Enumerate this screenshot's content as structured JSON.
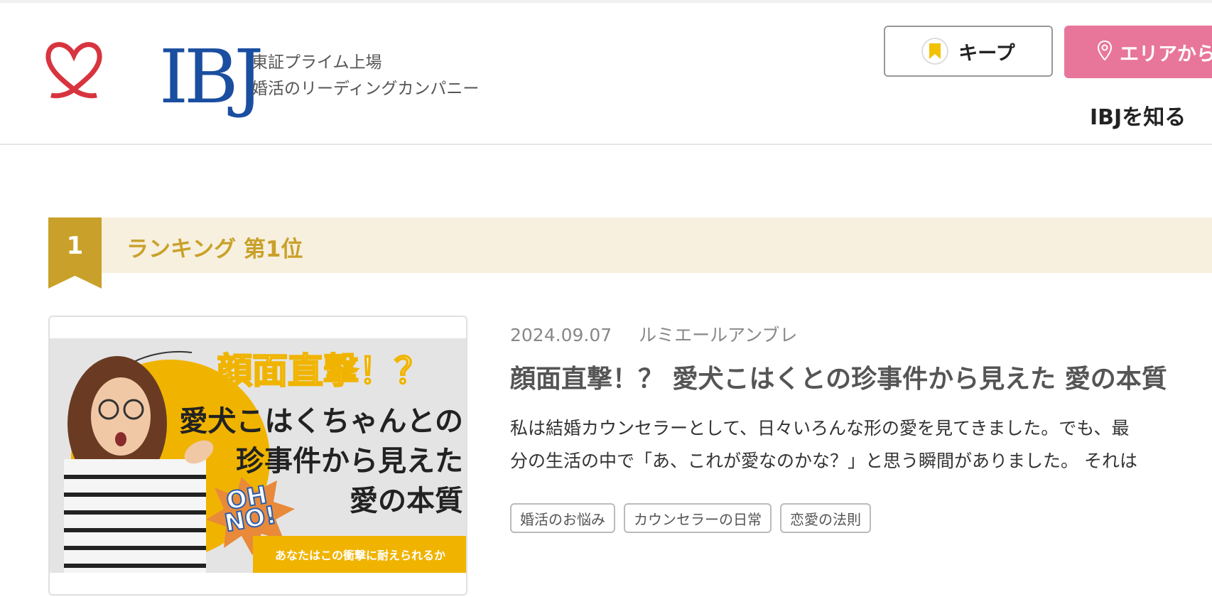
{
  "header": {
    "logo_text": "IBJ",
    "tagline_line1": "東証プライム上場",
    "tagline_line2": "婚活のリーディングカンパニー",
    "keep_label": "キープ",
    "area_label": "エリアから",
    "know_link": "IBJを知る"
  },
  "ranking": {
    "number": "1",
    "label": "ランキング 第1位"
  },
  "article": {
    "date": "2024.09.07",
    "author": "ルミエールアンブレ",
    "title": "顔面直撃！？ 愛犬こはくとの珍事件から見えた 愛の本質",
    "excerpt_line1": "私は結婚カウンセラーとして、日々いろんな形の愛を見てきました。でも、最",
    "excerpt_line2": "分の生活の中で「あ、これが愛なのかな？」と思う瞬間がありました。 それは",
    "tags": [
      "婚活のお悩み",
      "カウンセラーの日常",
      "恋愛の法則"
    ],
    "thumbnail": {
      "title": "顔面直撃！？",
      "line1": "愛犬こはくちゃんとの",
      "line2": "珍事件から見えた",
      "line3": "愛の本質",
      "burst": "OH NO!",
      "footer": "あなたはこの衝撃に耐えられるか"
    }
  },
  "colors": {
    "brand_blue": "#1a4ea0",
    "logo_red": "#d8343f",
    "area_pink": "#e8769a",
    "rank_gold": "#c9a12a",
    "rank_bg": "#f7f0df",
    "thumb_yellow": "#f0b400"
  },
  "icons": {
    "keep": "bookmark-icon",
    "area": "map-pin-icon"
  }
}
